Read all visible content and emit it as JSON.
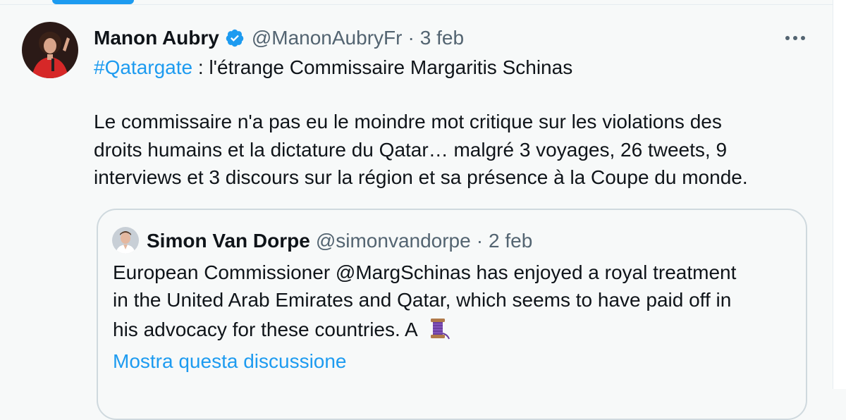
{
  "tweet": {
    "author_name": "Manon Aubry",
    "handle": "@ManonAubryFr",
    "separator": "·",
    "date": "3 feb",
    "hashtag": "#Qatargate",
    "line1_rest": " : l'étrange Commissaire Margaritis Schinas",
    "body_lines": [
      "Le commissaire n'a pas eu le moindre mot critique sur les violations des",
      "droits humains et la dictature du Qatar… malgré 3 voyages, 26 tweets, 9",
      "interviews et 3 discours sur la région et sa présence à la Coupe du monde."
    ]
  },
  "quoted": {
    "author_name": "Simon Van Dorpe",
    "handle": "@simonvandorpe",
    "separator": "·",
    "date": "2 feb",
    "body_lines": [
      "European Commissioner @MargSchinas has enjoyed a royal treatment",
      "in the United Arab Emirates and Qatar, which seems to have paid off in",
      "his advocacy for these countries. A"
    ],
    "emoji": "thread-spool-icon",
    "show_thread": "Mostra questa discussione"
  },
  "colors": {
    "accent": "#1d9bf0",
    "secondary_text": "#536471",
    "border": "#cfd9de",
    "background": "#f7f9f9"
  }
}
